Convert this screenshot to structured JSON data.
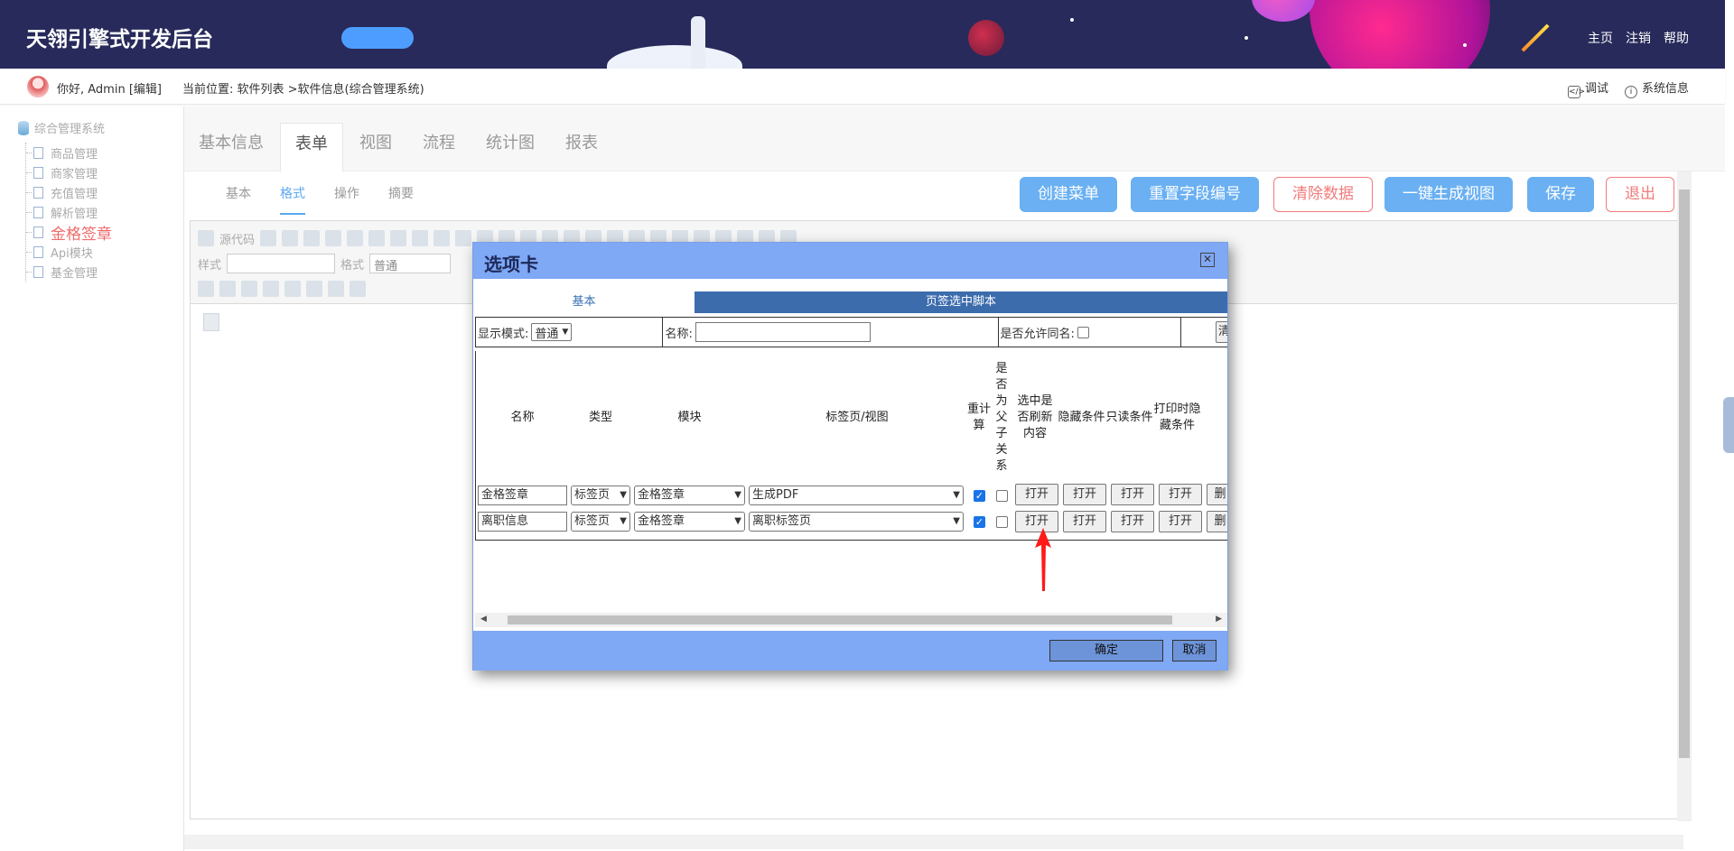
{
  "header": {
    "app_title": "天翎引擎式开发后台",
    "nav": [
      "主页",
      "注销",
      "帮助"
    ]
  },
  "infobar": {
    "greeting": "你好, Admin [编辑]",
    "location": "当前位置: 软件列表 >软件信息(综合管理系统)",
    "debug": "调试",
    "sysinfo": "系统信息"
  },
  "tree": {
    "root": "综合管理系统",
    "items": [
      "商品管理",
      "商家管理",
      "充值管理",
      "解析管理",
      "金格签章",
      "Api模块",
      "基金管理"
    ],
    "active_index": 4
  },
  "tabs": [
    "基本信息",
    "表单",
    "视图",
    "流程",
    "统计图",
    "报表"
  ],
  "active_tab": 1,
  "subtabs": [
    "基本",
    "格式",
    "操作",
    "摘要"
  ],
  "active_subtab": 1,
  "actions": {
    "create_menu": "创建菜单",
    "reset_field_no": "重置字段编号",
    "clear_data": "清除数据",
    "gen_view": "一键生成视图",
    "save": "保存",
    "exit": "退出"
  },
  "editor": {
    "source_code": "源代码",
    "style_label": "样式",
    "format_label": "格式",
    "format_value": "普通"
  },
  "dialog": {
    "title": "选项卡",
    "tab_basic": "基本",
    "tab_script": "页签选中脚本",
    "display_mode_label": "显示模式:",
    "display_mode_value": "普通",
    "name_label": "名称:",
    "name_value": "",
    "allow_same_name_label": "是否允许同名:",
    "cut_off_button": "清",
    "columns": {
      "name": "名称",
      "type": "类型",
      "module": "模块",
      "tabview": "标签页/视图",
      "recalc": "重计算",
      "parent_child": "是否为父子关系",
      "refresh": "选中是否刷新内容",
      "hide": "隐藏条件",
      "readonly": "只读条件",
      "print_hide": "打印时隐藏条件"
    },
    "rows": [
      {
        "name": "金格签章",
        "type": "标签页",
        "module": "金格签章",
        "view": "生成PDF",
        "recalc": true,
        "parent_child": false,
        "btn": "打开",
        "delete": "删"
      },
      {
        "name": "离职信息",
        "type": "标签页",
        "module": "金格签章",
        "view": "离职标签页",
        "recalc": true,
        "parent_child": false,
        "btn": "打开",
        "delete": "删"
      }
    ],
    "ok": "确定",
    "cancel": "取消"
  },
  "colors": {
    "banner": "#272a5a",
    "accent_blue": "#6ab0f2",
    "danger": "#f27b7b",
    "dialog_header": "#7fa8f5",
    "arrow": "#ff1a1a"
  }
}
